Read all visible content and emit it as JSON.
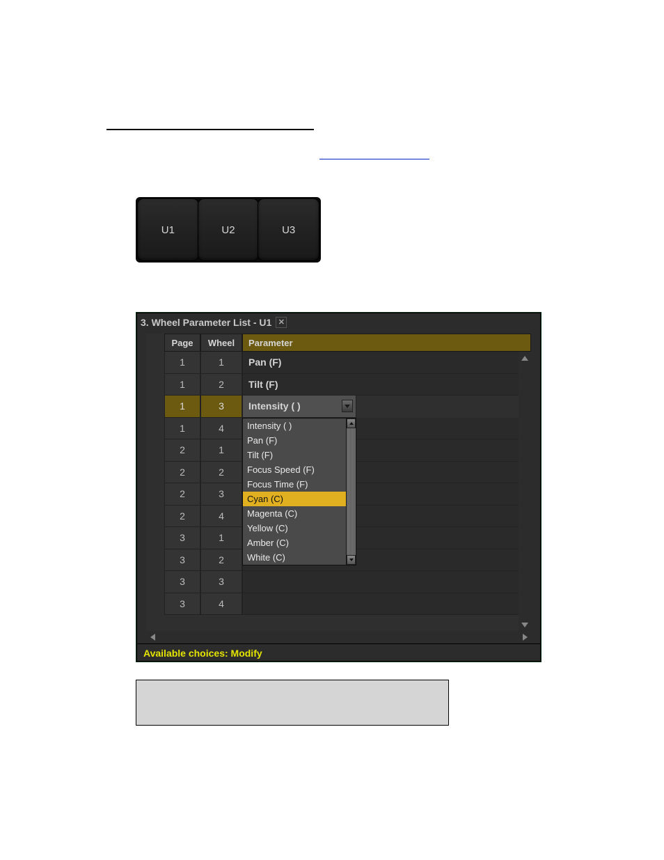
{
  "ukeys": [
    "U1",
    "U2",
    "U3"
  ],
  "dialog": {
    "title": "3. Wheel Parameter List - U1",
    "columns": {
      "page": "Page",
      "wheel": "Wheel",
      "parameter": "Parameter"
    },
    "rows": [
      {
        "page": "1",
        "wheel": "1",
        "parameter": "Pan (F)",
        "selected": false
      },
      {
        "page": "1",
        "wheel": "2",
        "parameter": "Tilt (F)",
        "selected": false
      },
      {
        "page": "1",
        "wheel": "3",
        "parameter": "Intensity ( )",
        "selected": true
      },
      {
        "page": "1",
        "wheel": "4",
        "parameter": "",
        "selected": false
      },
      {
        "page": "2",
        "wheel": "1",
        "parameter": "",
        "selected": false
      },
      {
        "page": "2",
        "wheel": "2",
        "parameter": "",
        "selected": false
      },
      {
        "page": "2",
        "wheel": "3",
        "parameter": "",
        "selected": false
      },
      {
        "page": "2",
        "wheel": "4",
        "parameter": "",
        "selected": false
      },
      {
        "page": "3",
        "wheel": "1",
        "parameter": "",
        "selected": false
      },
      {
        "page": "3",
        "wheel": "2",
        "parameter": "",
        "selected": false
      },
      {
        "page": "3",
        "wheel": "3",
        "parameter": "",
        "selected": false
      },
      {
        "page": "3",
        "wheel": "4",
        "parameter": "",
        "selected": false
      }
    ],
    "dropdown": {
      "options": [
        "Intensity ( )",
        "Pan (F)",
        "Tilt (F)",
        "Focus Speed (F)",
        "Focus Time (F)",
        "Cyan (C)",
        "Magenta (C)",
        "Yellow (C)",
        "Amber (C)",
        "White (C)"
      ],
      "highlighted_index": 5
    },
    "status": "Available choices: Modify"
  }
}
